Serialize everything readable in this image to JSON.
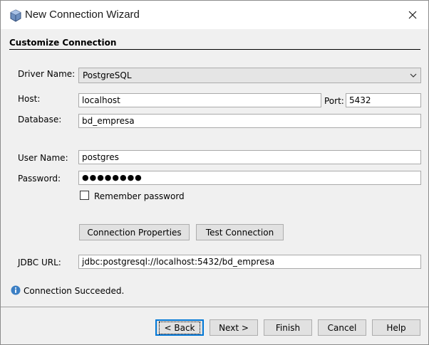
{
  "window": {
    "title": "New Connection Wizard"
  },
  "section": {
    "title": "Customize Connection"
  },
  "form": {
    "driver_label": "Driver Name:",
    "driver_value": "PostgreSQL",
    "host_label": "Host:",
    "host_value": "localhost",
    "port_label": "Port:",
    "port_value": "5432",
    "database_label": "Database:",
    "database_value": "bd_empresa",
    "username_label": "User Name:",
    "username_value": "postgres",
    "password_label": "Password:",
    "password_mask": "●●●●●●●●",
    "remember_label": "Remember password",
    "remember_checked": false,
    "jdbc_label": "JDBC URL:",
    "jdbc_value": "jdbc:postgresql://localhost:5432/bd_empresa"
  },
  "actions": {
    "connection_properties": "Connection Properties",
    "test_connection": "Test Connection"
  },
  "status": {
    "message": "Connection Succeeded.",
    "icon": "info-icon"
  },
  "footer": {
    "back": "< Back",
    "next": "Next >",
    "finish": "Finish",
    "cancel": "Cancel",
    "help": "Help"
  },
  "colors": {
    "accent": "#0078d7",
    "info": "#3c7fc4",
    "dialog_bg": "#f0f0f0"
  }
}
